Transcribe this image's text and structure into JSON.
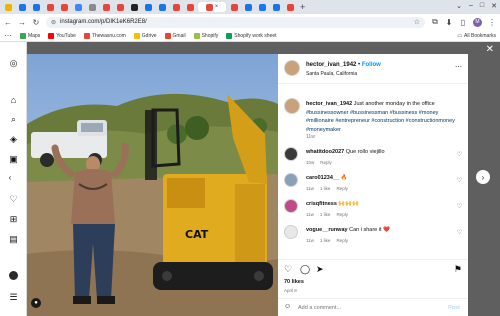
{
  "browser": {
    "tabs": [
      {
        "color": "#f0b400"
      },
      {
        "color": "#1a73e8"
      },
      {
        "color": "#1a73e8"
      },
      {
        "color": "#e5463b"
      },
      {
        "color": "#e5463b"
      },
      {
        "color": "#4285f4"
      },
      {
        "color": "#8a8a8a"
      },
      {
        "color": "#e5463b"
      },
      {
        "color": "#e5463b"
      },
      {
        "color": "#222222"
      },
      {
        "color": "#1a73e8"
      },
      {
        "color": "#1a73e8"
      },
      {
        "color": "#e5463b"
      },
      {
        "color": "#e5463b"
      },
      {
        "color": "#e5463b"
      },
      {
        "color": "#e5463b"
      },
      {
        "color": "#1a73e8"
      },
      {
        "color": "#1877f2"
      },
      {
        "color": "#1a73e8"
      },
      {
        "color": "#ea4335"
      }
    ],
    "active_tab_close": "×",
    "new_tab": "+",
    "url": "instagram.com/p/DIK1eK6R2E8/",
    "profile_initial": "M",
    "bookmarks": [
      {
        "label": "Maps",
        "color": "#34a853"
      },
      {
        "label": "YouTube",
        "color": "#ff0000"
      },
      {
        "label": "Thewasnu.com",
        "color": "#e5463b"
      },
      {
        "label": "Gdrive",
        "color": "#fbbc04"
      },
      {
        "label": "Gmail",
        "color": "#ea4335"
      },
      {
        "label": "Shopify",
        "color": "#95bf47"
      },
      {
        "label": "Shopify work sheet",
        "color": "#0f9d58"
      }
    ],
    "all_bookmarks": "All Bookmarks"
  },
  "post": {
    "username": "hector_ivan_1942",
    "follow_label": "Follow",
    "location": "Santa Paula, California",
    "caption_text": "Just another monday in the office",
    "caption_tags": "#bussinessowner #bussinessman #bussiness #money #millionaire #entrepreneur #construction #constructionmoney #moneymaker",
    "caption_time": "11w",
    "comments": [
      {
        "user": "whatitdoo2027",
        "text": "Que rollo viejillo",
        "time": "10w",
        "likes": "",
        "reply": "Reply",
        "avatar": "#3a3a3a"
      },
      {
        "user": "caro01234__",
        "text": "🔥",
        "time": "11w",
        "likes": "1 like",
        "reply": "Reply",
        "avatar": "#8aa0b8"
      },
      {
        "user": "crisqfitness",
        "text": "🙌🙌🙌",
        "time": "11w",
        "likes": "1 like",
        "reply": "Reply",
        "avatar": "#c04a8a"
      },
      {
        "user": "vogue__runway",
        "text": "Can i share it ❤️",
        "time": "11w",
        "likes": "1 like",
        "reply": "Reply",
        "avatar": "#e8e8e8"
      }
    ],
    "likes": "70 likes",
    "date": "April 8",
    "add_comment_placeholder": "Add a comment...",
    "post_label": "Post"
  },
  "colors": {
    "accent": "#0095f6",
    "link": "#00376b"
  }
}
